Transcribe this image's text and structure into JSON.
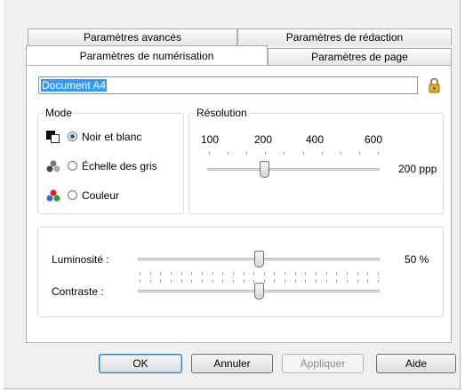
{
  "tabs": {
    "row_back": [
      "Paramètres avancés",
      "Paramètres de rédaction"
    ],
    "row_front": [
      "Paramètres de numérisation",
      "Paramètres de page"
    ],
    "active": "Paramètres de numérisation"
  },
  "profile": {
    "name_value": "Document A4"
  },
  "mode": {
    "title": "Mode",
    "options": [
      "Noir et blanc",
      "Échelle des gris",
      "Couleur"
    ],
    "selected": "Noir et blanc"
  },
  "resolution": {
    "title": "Résolution",
    "scale_labels": [
      "100",
      "200",
      "400",
      "600"
    ],
    "value_text": "200 ppp",
    "position_fraction": 0.33
  },
  "brightness": {
    "label": "Luminosité :",
    "value_text": "50 %",
    "position_fraction": 0.5
  },
  "contrast": {
    "label": "Contraste :",
    "position_fraction": 0.5
  },
  "buttons": {
    "ok": "OK",
    "cancel": "Annuler",
    "apply": "Appliquer",
    "help": "Aide"
  },
  "colors": {
    "selection": "#3399ff",
    "radio_dot": "#1f5fb8",
    "group_border": "#d5dfe5"
  }
}
